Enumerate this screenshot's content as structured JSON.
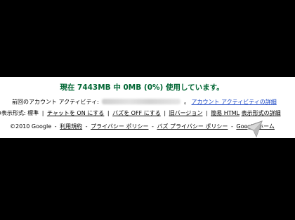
{
  "storage": {
    "text": "現在 7443MB 中 0MB (0%) 使用しています。"
  },
  "activity": {
    "label": "前回のアカウント アクティビティ:",
    "suffix": "。",
    "details_link": "アカウント アクティビティの詳細"
  },
  "modes": {
    "label": "ail の表示形式: 標準",
    "chat_on": "チャットを ON にする",
    "buzz_off": "バズを OFF にする",
    "old_version": "旧バージョン",
    "basic_html": "簡易 HTML",
    "details": "表示形式の詳細"
  },
  "footer": {
    "copyright": "©2010 Google",
    "terms": "利用規約",
    "privacy": "プライバシー ポリシー",
    "buzz_privacy": "バズ プライバシー ポリシー",
    "home": "Google ホーム"
  }
}
